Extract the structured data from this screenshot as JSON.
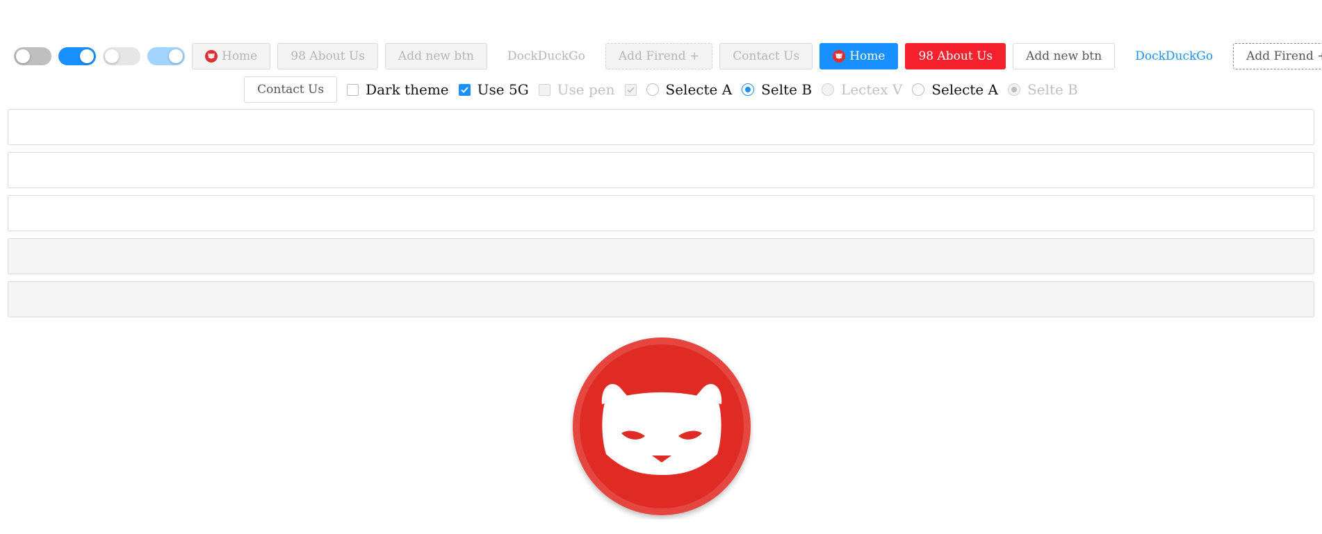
{
  "row1": {
    "buttons_disabled": {
      "home": "Home",
      "about": "98 About Us",
      "add_new": "Add new btn",
      "duck": "DockDuckGo",
      "add_friend": "Add Firend +",
      "contact": "Contact Us"
    },
    "buttons_enabled": {
      "home": "Home",
      "about": "98 About Us",
      "add_new": "Add new btn",
      "duck": "DockDuckGo",
      "add_friend": "Add Firend +"
    }
  },
  "row2": {
    "contact": "Contact Us",
    "checkboxes": [
      {
        "label": "Dark theme",
        "checked": false,
        "disabled": false
      },
      {
        "label": "Use 5G",
        "checked": true,
        "disabled": false
      },
      {
        "label": "Use pen",
        "checked": false,
        "disabled": true
      },
      {
        "label": "",
        "checked": true,
        "disabled": true
      }
    ],
    "radios": [
      {
        "label": "Selecte A",
        "checked": false,
        "disabled": false
      },
      {
        "label": "Selte B",
        "checked": true,
        "disabled": false
      },
      {
        "label": "Lectex V",
        "checked": false,
        "disabled": true
      },
      {
        "label": "Selecte A",
        "checked": false,
        "disabled": false
      },
      {
        "label": "Selte B",
        "checked": true,
        "disabled": true
      }
    ]
  },
  "toggles": [
    {
      "state": "off",
      "disabled": false
    },
    {
      "state": "on",
      "disabled": false
    },
    {
      "state": "off",
      "disabled": true
    },
    {
      "state": "on",
      "disabled": true
    }
  ],
  "inputs": [
    {
      "value": "",
      "placeholder": "",
      "disabled": false
    },
    {
      "value": "",
      "placeholder": "",
      "disabled": false
    },
    {
      "value": "",
      "placeholder": "",
      "disabled": false
    },
    {
      "value": "",
      "placeholder": "",
      "disabled": true
    },
    {
      "value": "",
      "placeholder": "",
      "disabled": true
    }
  ],
  "colors": {
    "primary": "#1890ff",
    "danger": "#f5222d",
    "logo_red": "#e02f2f"
  },
  "icons": {
    "mini": "bear-icon",
    "logo": "bear-logo"
  }
}
